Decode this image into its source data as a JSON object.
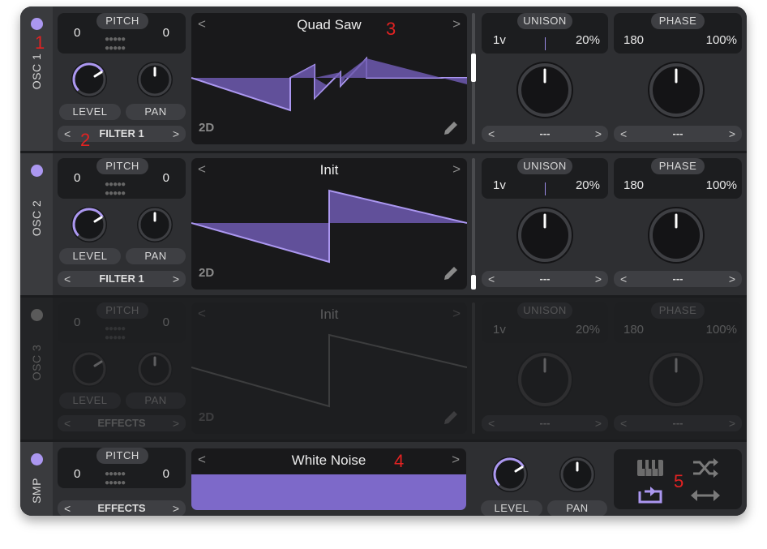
{
  "osc1": {
    "label": "OSC 1",
    "pitch_label": "PITCH",
    "pitch_left": "0",
    "pitch_right": "0",
    "level_label": "LEVEL",
    "pan_label": "PAN",
    "destination": "FILTER 1",
    "wave_name": "Quad Saw",
    "mode": "2D",
    "unison_label": "UNISON",
    "unison_voices": "1v",
    "unison_detune": "20%",
    "phase_label": "PHASE",
    "phase_value": "180",
    "phase_random": "100%",
    "unison_sel": "---",
    "phase_sel": "---"
  },
  "osc2": {
    "label": "OSC 2",
    "pitch_label": "PITCH",
    "pitch_left": "0",
    "pitch_right": "0",
    "level_label": "LEVEL",
    "pan_label": "PAN",
    "destination": "FILTER 1",
    "wave_name": "Init",
    "mode": "2D",
    "unison_label": "UNISON",
    "unison_voices": "1v",
    "unison_detune": "20%",
    "phase_label": "PHASE",
    "phase_value": "180",
    "phase_random": "100%",
    "unison_sel": "---",
    "phase_sel": "---"
  },
  "osc3": {
    "label": "OSC 3",
    "pitch_label": "PITCH",
    "pitch_left": "0",
    "pitch_right": "0",
    "level_label": "LEVEL",
    "pan_label": "PAN",
    "destination": "EFFECTS",
    "wave_name": "Init",
    "mode": "2D",
    "unison_label": "UNISON",
    "unison_voices": "1v",
    "unison_detune": "20%",
    "phase_label": "PHASE",
    "phase_value": "180",
    "phase_random": "100%",
    "unison_sel": "---",
    "phase_sel": "---"
  },
  "smp": {
    "label": "SMP",
    "pitch_label": "PITCH",
    "pitch_left": "0",
    "pitch_right": "0",
    "destination": "EFFECTS",
    "sample_name": "White Noise",
    "level_label": "LEVEL",
    "pan_label": "PAN"
  },
  "nav": {
    "left": "<",
    "right": ">"
  },
  "annotations": [
    "1",
    "2",
    "3",
    "4",
    "5"
  ],
  "colors": {
    "accent": "#ab97f0",
    "panel": "#2e2f32",
    "display": "#19191b",
    "annotation": "#e22222"
  },
  "icons": [
    "pencil-icon",
    "keyboard-icon",
    "random-icon",
    "loop-icon",
    "bounce-icon"
  ]
}
